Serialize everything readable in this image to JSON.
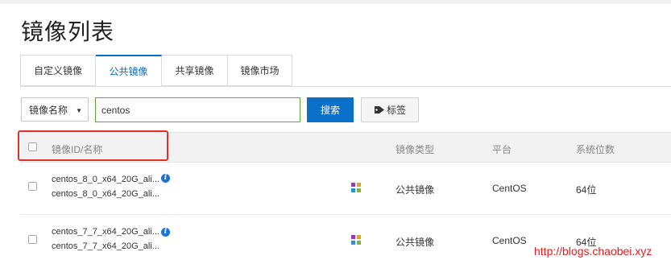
{
  "page": {
    "title": "镜像列表"
  },
  "tabs": [
    {
      "label": "自定义镜像",
      "active": false
    },
    {
      "label": "公共镜像",
      "active": true
    },
    {
      "label": "共享镜像",
      "active": false
    },
    {
      "label": "镜像市场",
      "active": false
    }
  ],
  "filter": {
    "field_label": "镜像名称",
    "query": "centos",
    "search_label": "搜索",
    "tag_label": "标签"
  },
  "table": {
    "headers": {
      "name": "镜像ID/名称",
      "type": "镜像类型",
      "platform": "平台",
      "bits": "系统位数"
    },
    "rows": [
      {
        "id": "centos_8_0_x64_20G_ali...",
        "name": "centos_8_0_x64_20G_ali...",
        "type": "公共镜像",
        "platform": "CentOS",
        "bits": "64位"
      },
      {
        "id": "centos_7_7_x64_20G_ali...",
        "name": "centos_7_7_x64_20G_ali...",
        "type": "公共镜像",
        "platform": "CentOS",
        "bits": "64位"
      }
    ]
  },
  "watermark": "http://blogs.chaobei.xyz",
  "colors": {
    "accent": "#0b70c9",
    "highlight": "#e0302a",
    "input_border": "#61a83b"
  }
}
